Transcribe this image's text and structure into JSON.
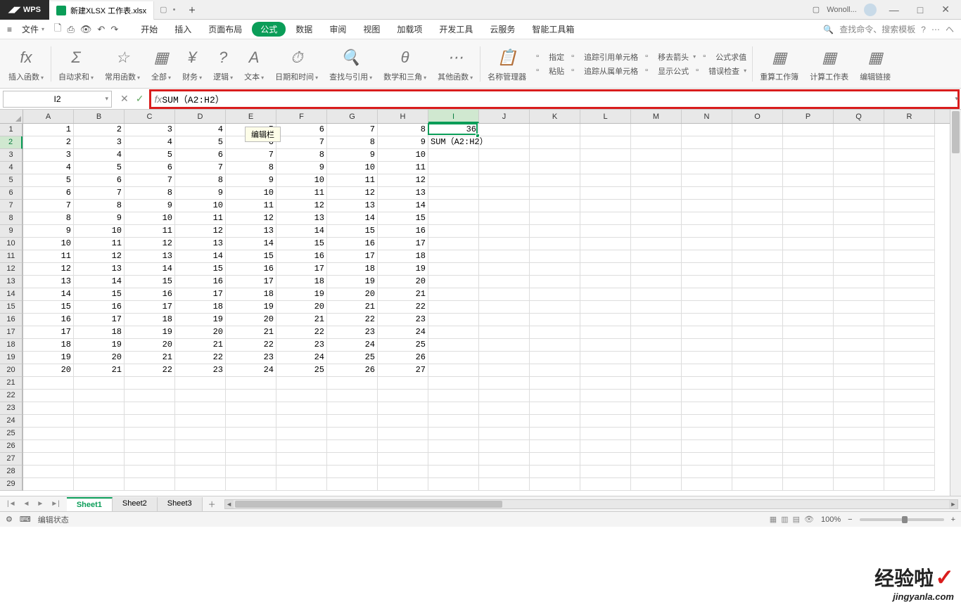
{
  "titlebar": {
    "app": "WPS",
    "filename": "新建XLSX 工作表.xlsx",
    "plus": "＋",
    "user": "Wonoll...",
    "min": "—",
    "max": "□",
    "close": "✕",
    "layout": "▢"
  },
  "menubar": {
    "file": "文件",
    "tabs": [
      "开始",
      "插入",
      "页面布局",
      "公式",
      "数据",
      "审阅",
      "视图",
      "加载项",
      "开发工具",
      "云服务",
      "智能工具箱"
    ],
    "active_index": 3,
    "search_placeholder": "查找命令、搜索模板",
    "help": "?"
  },
  "ribbon": {
    "items": [
      {
        "icon": "fx",
        "label": "插入函数"
      },
      {
        "icon": "Σ",
        "label": "自动求和"
      },
      {
        "icon": "☆",
        "label": "常用函数"
      },
      {
        "icon": "▦",
        "label": "全部"
      },
      {
        "icon": "¥",
        "label": "财务"
      },
      {
        "icon": "?",
        "label": "逻辑"
      },
      {
        "icon": "A",
        "label": "文本"
      },
      {
        "icon": "⏱",
        "label": "日期和时间"
      },
      {
        "icon": "🔍",
        "label": "查找与引用"
      },
      {
        "icon": "θ",
        "label": "数学和三角"
      },
      {
        "icon": "⋯",
        "label": "其他函数"
      }
    ],
    "names_mgr": "名称管理器",
    "right_stack": [
      [
        "指定",
        "追踪引用单元格",
        "移去箭头",
        "公式求值"
      ],
      [
        "粘贴",
        "追踪从属单元格",
        "显示公式",
        "错误检查"
      ]
    ],
    "right_large": [
      "重算工作簿",
      "计算工作表",
      "编辑链接"
    ]
  },
  "formula_bar": {
    "cell_ref": "I2",
    "formula": "SUM（A2:H2）",
    "tooltip": "编辑栏"
  },
  "grid": {
    "cols": [
      "A",
      "B",
      "C",
      "D",
      "E",
      "F",
      "G",
      "H",
      "I",
      "J",
      "K",
      "L",
      "M",
      "N",
      "O",
      "P",
      "Q",
      "R"
    ],
    "active_col_index": 8,
    "rows_shown": 29,
    "active_row": 2,
    "i1_value": "36",
    "i2_formula_display": "SUM（A2:H2）",
    "data": [
      [
        1,
        2,
        3,
        4,
        5,
        6,
        7,
        8
      ],
      [
        2,
        3,
        4,
        5,
        6,
        7,
        8,
        9
      ],
      [
        3,
        4,
        5,
        6,
        7,
        8,
        9,
        10
      ],
      [
        4,
        5,
        6,
        7,
        8,
        9,
        10,
        11
      ],
      [
        5,
        6,
        7,
        8,
        9,
        10,
        11,
        12
      ],
      [
        6,
        7,
        8,
        9,
        10,
        11,
        12,
        13
      ],
      [
        7,
        8,
        9,
        10,
        11,
        12,
        13,
        14
      ],
      [
        8,
        9,
        10,
        11,
        12,
        13,
        14,
        15
      ],
      [
        9,
        10,
        11,
        12,
        13,
        14,
        15,
        16
      ],
      [
        10,
        11,
        12,
        13,
        14,
        15,
        16,
        17
      ],
      [
        11,
        12,
        13,
        14,
        15,
        16,
        17,
        18
      ],
      [
        12,
        13,
        14,
        15,
        16,
        17,
        18,
        19
      ],
      [
        13,
        14,
        15,
        16,
        17,
        18,
        19,
        20
      ],
      [
        14,
        15,
        16,
        17,
        18,
        19,
        20,
        21
      ],
      [
        15,
        16,
        17,
        18,
        19,
        20,
        21,
        22
      ],
      [
        16,
        17,
        18,
        19,
        20,
        21,
        22,
        23
      ],
      [
        17,
        18,
        19,
        20,
        21,
        22,
        23,
        24
      ],
      [
        18,
        19,
        20,
        21,
        22,
        23,
        24,
        25
      ],
      [
        19,
        20,
        21,
        22,
        23,
        24,
        25,
        26
      ],
      [
        20,
        21,
        22,
        23,
        24,
        25,
        26,
        27
      ]
    ]
  },
  "sheets": {
    "list": [
      "Sheet1",
      "Sheet2",
      "Sheet3"
    ],
    "active": 0,
    "add": "＋"
  },
  "statusbar": {
    "mode": "编辑状态",
    "zoom": "100%"
  },
  "watermark": {
    "main": "经验啦",
    "sub": "jingyanla.com"
  }
}
